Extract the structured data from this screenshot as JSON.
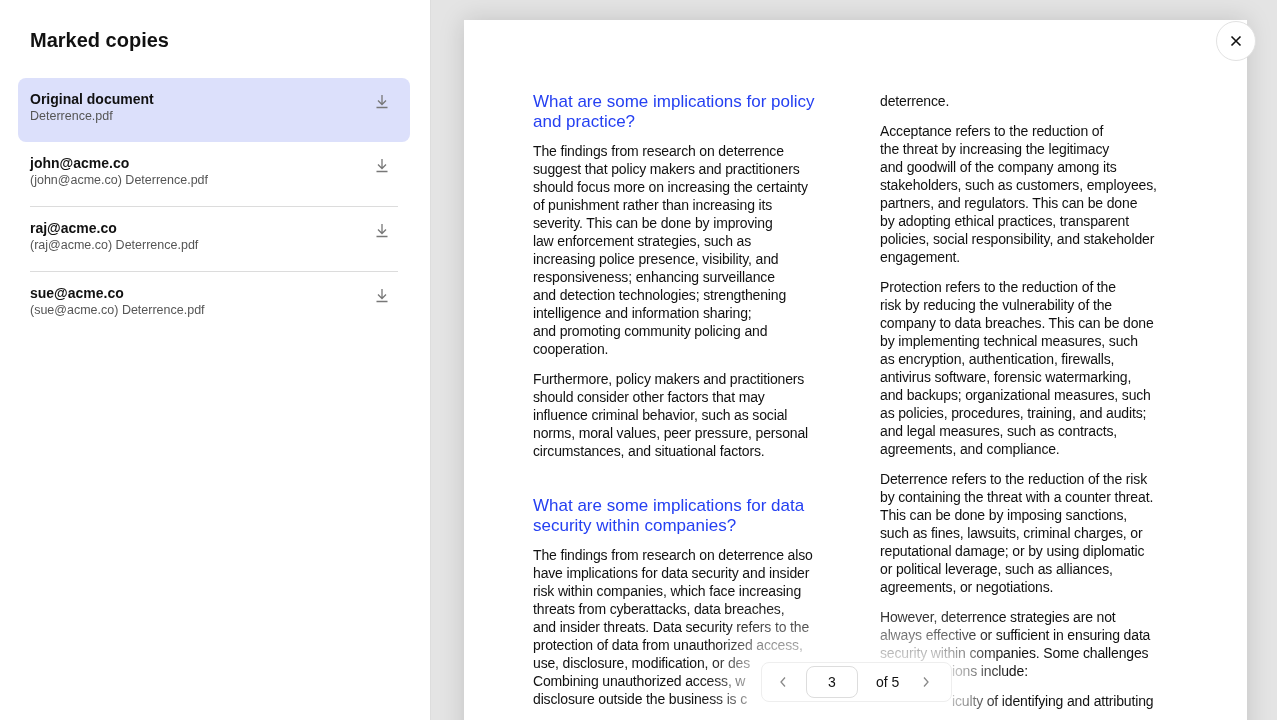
{
  "sidebar": {
    "title": "Marked copies",
    "items": [
      {
        "title": "Original document",
        "file": "Deterrence.pdf",
        "selected": true
      },
      {
        "title": "john@acme.co",
        "file": "(john@acme.co) Deterrence.pdf",
        "selected": false
      },
      {
        "title": "raj@acme.co",
        "file": "(raj@acme.co) Deterrence.pdf",
        "selected": false
      },
      {
        "title": "sue@acme.co",
        "file": "(sue@acme.co) Deterrence.pdf",
        "selected": false
      }
    ]
  },
  "document": {
    "columns": [
      [
        {
          "kind": "heading",
          "lines": [
            "What are some implications for policy",
            "and practice?"
          ]
        },
        {
          "kind": "paragraph",
          "lines": [
            "The findings from research on deterrence",
            "suggest that policy makers and practitioners",
            "should focus more on increasing the certainty",
            "of punishment rather than increasing its",
            "severity. This can be done by improving",
            "law enforcement strategies, such as",
            "increasing police presence, visibility, and",
            "responsiveness; enhancing surveillance",
            "and detection technologies; strengthening",
            "intelligence and information sharing;",
            "and promoting community policing and",
            "cooperation."
          ]
        },
        {
          "kind": "paragraph",
          "lines": [
            "Furthermore, policy makers and practitioners",
            "should consider other factors that may",
            "influence criminal behavior, such as social",
            "norms, moral values, peer pressure, personal",
            "circumstances, and situational factors."
          ]
        },
        {
          "kind": "heading",
          "lines": [
            "What are some implications for data",
            "security within companies?"
          ]
        },
        {
          "kind": "paragraph-open",
          "lines": [
            "The findings from research on deterrence also",
            "have implications for data security and insider",
            "risk within companies, which face increasing",
            "threats from cyberattacks, data breaches,",
            "and insider threats. Data security refers to the",
            "protection of data from unauthorized access,"
          ]
        },
        {
          "kind": "fragment",
          "lines": [
            "use, disclosure, modification, or des",
            "Combining unauthorized access, w",
            "disclosure outside the business is c"
          ]
        }
      ],
      [
        {
          "kind": "paragraph",
          "lines": [
            "deterrence."
          ]
        },
        {
          "kind": "paragraph",
          "lines": [
            "Acceptance refers to the reduction of",
            "the threat by increasing the legitimacy",
            "and goodwill of the company among its",
            "stakeholders, such as customers, employees,",
            "partners, and regulators. This can be done",
            "by adopting ethical practices, transparent",
            "policies, social responsibility, and stakeholder",
            "engagement."
          ]
        },
        {
          "kind": "paragraph",
          "lines": [
            "Protection refers to the reduction of the",
            "risk by reducing the vulnerability of the",
            "company to data breaches. This can be done",
            "by implementing technical measures, such",
            "as encryption, authentication, firewalls,",
            "antivirus software, forensic watermarking,",
            "and backups; organizational measures, such",
            "as policies, procedures, training, and audits;",
            "and legal measures, such as contracts,",
            "agreements, and compliance."
          ]
        },
        {
          "kind": "paragraph",
          "lines": [
            "Deterrence refers to the reduction of the risk",
            "by containing the threat with a counter threat.",
            "This can be done by imposing sanctions,",
            "such as fines, lawsuits, criminal charges, or",
            "reputational damage; or by using diplomatic",
            "or political leverage, such as alliances,",
            "agreements, or negotiations."
          ]
        },
        {
          "kind": "paragraph-open",
          "lines": [
            "However, deterrence strategies are not",
            "always effective or sufficient in ensuring data",
            "security within companies. Some challenges"
          ]
        },
        {
          "kind": "fragment",
          "lines": [
            "ions include:"
          ]
        },
        {
          "kind": "list-item",
          "lines": [
            "iculty of identifying and attributing"
          ]
        }
      ]
    ]
  },
  "pager": {
    "page": "3",
    "total": "of 5"
  }
}
